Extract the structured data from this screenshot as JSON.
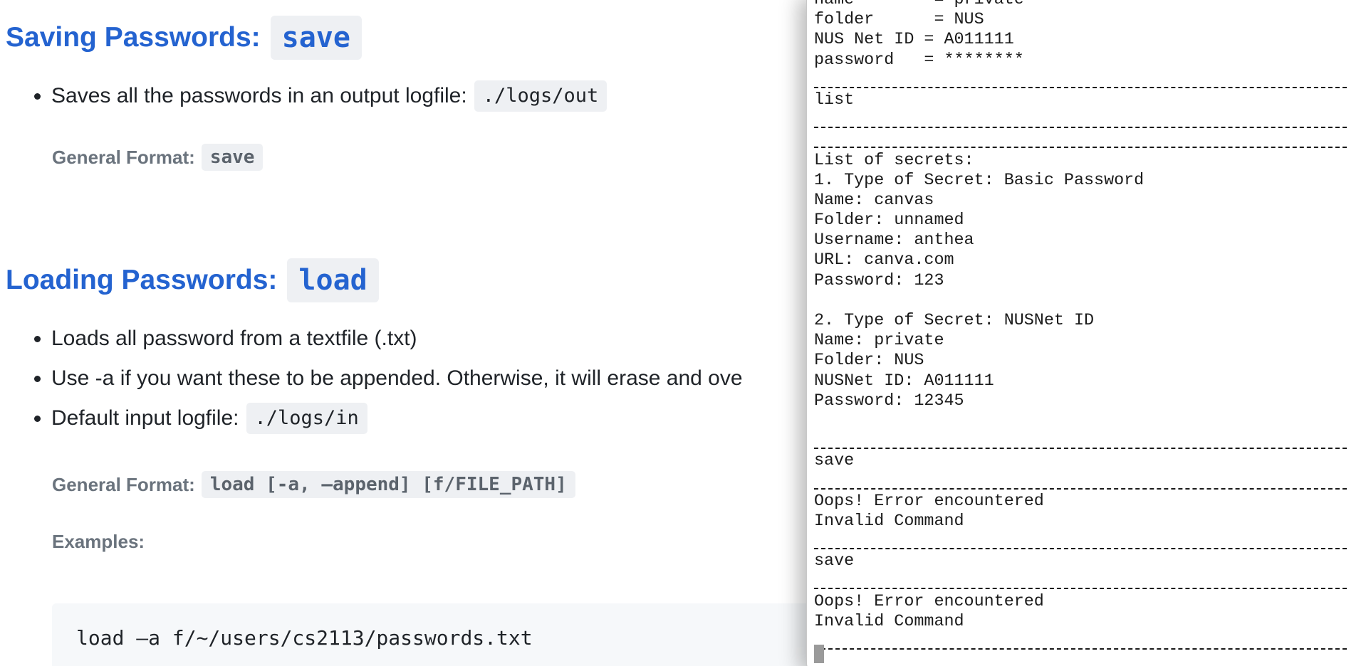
{
  "doc": {
    "save_section": {
      "heading": "Saving Passwords:",
      "command": "save",
      "bullets": [
        {
          "text": "Saves all the passwords in an output logfile:",
          "code": "./logs/out"
        }
      ],
      "format_label": "General Format:",
      "format_code": "save"
    },
    "load_section": {
      "heading": "Loading Passwords:",
      "command": "load",
      "bullets": [
        {
          "text": "Loads all password from a textfile (.txt)"
        },
        {
          "text": "Use -a if you want these to be appended. Otherwise, it will erase and ove"
        },
        {
          "text": "Default input logfile:",
          "code": "./logs/in"
        }
      ],
      "format_label": "General Format:",
      "format_code": "load [-a, –append] [f/FILE_PATH]",
      "examples_label": "Examples:",
      "example_code": "load –a f/~/users/cs2113/passwords.txt"
    }
  },
  "terminal": {
    "lines": [
      {
        "text": "name        = private"
      },
      {
        "text": "folder      = NUS"
      },
      {
        "text": "NUS Net ID = A011111"
      },
      {
        "text": "password   = ********"
      },
      {
        "text": "",
        "sep": true
      },
      {
        "text": "list"
      },
      {
        "text": "",
        "sep": true
      },
      {
        "text": "",
        "sep": true
      },
      {
        "text": "List of secrets:"
      },
      {
        "text": "1. Type of Secret: Basic Password"
      },
      {
        "text": "Name: canvas"
      },
      {
        "text": "Folder: unnamed"
      },
      {
        "text": "Username: anthea"
      },
      {
        "text": "URL: canva.com"
      },
      {
        "text": "Password: 123"
      },
      {
        "text": ""
      },
      {
        "text": "2. Type of Secret: NUSNet ID"
      },
      {
        "text": "Name: private"
      },
      {
        "text": "Folder: NUS"
      },
      {
        "text": "NUSNet ID: A011111"
      },
      {
        "text": "Password: 12345"
      },
      {
        "text": ""
      },
      {
        "text": "",
        "sep": true
      },
      {
        "text": "save"
      },
      {
        "text": "",
        "sep": true
      },
      {
        "text": "Oops! Error encountered"
      },
      {
        "text": "Invalid Command"
      },
      {
        "text": "",
        "sep": true
      },
      {
        "text": "save"
      },
      {
        "text": "",
        "sep": true
      },
      {
        "text": "Oops! Error encountered"
      },
      {
        "text": "Invalid Command"
      },
      {
        "text": "",
        "sep": true
      }
    ]
  }
}
